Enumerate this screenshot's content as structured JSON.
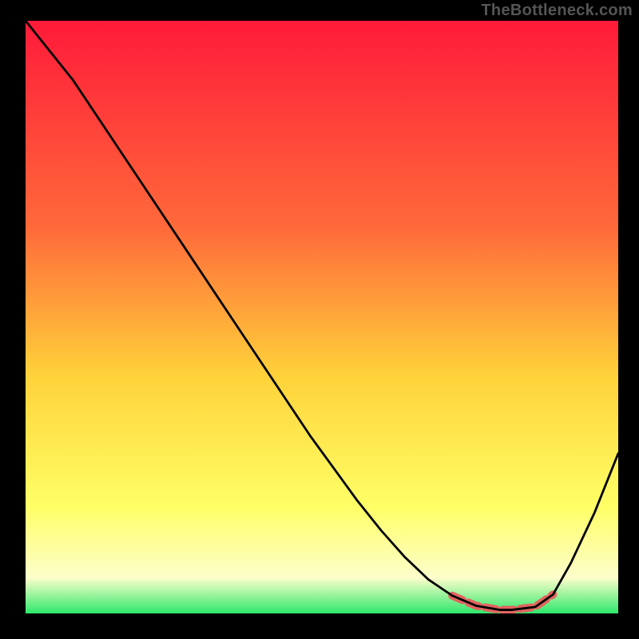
{
  "watermark": "TheBottleneck.com",
  "colors": {
    "background": "#000000",
    "curve": "#000000",
    "highlight": "#e2645f",
    "gradient_top": "#ff1a3a",
    "gradient_mid1": "#ff6a3a",
    "gradient_mid2": "#ffd23a",
    "gradient_mid3": "#ffff66",
    "gradient_mid4": "#fdfecb",
    "gradient_bottom": "#2ee86b"
  },
  "chart_data": {
    "type": "line",
    "title": "",
    "xlabel": "",
    "ylabel": "",
    "xlim": [
      0,
      100
    ],
    "ylim": [
      0,
      100
    ],
    "grid": false,
    "legend": false,
    "series": [
      {
        "name": "bottleneck-curve",
        "x": [
          0,
          4,
          8,
          12,
          16,
          20,
          24,
          28,
          32,
          36,
          40,
          44,
          48,
          52,
          56,
          60,
          64,
          68,
          72,
          76,
          80,
          82,
          86,
          89,
          92,
          96,
          100
        ],
        "y": [
          100,
          95,
          90,
          84,
          78,
          72,
          66,
          60,
          54,
          48,
          42,
          36,
          30,
          24.5,
          19,
          14,
          9.5,
          5.7,
          3.0,
          1.3,
          0.6,
          0.6,
          1.1,
          3.2,
          8.5,
          17,
          27
        ]
      },
      {
        "name": "optimal-range",
        "x": [
          72,
          76,
          80,
          82,
          86,
          89
        ],
        "y": [
          3.0,
          1.3,
          0.6,
          0.6,
          1.1,
          3.2
        ]
      }
    ],
    "annotations": []
  }
}
